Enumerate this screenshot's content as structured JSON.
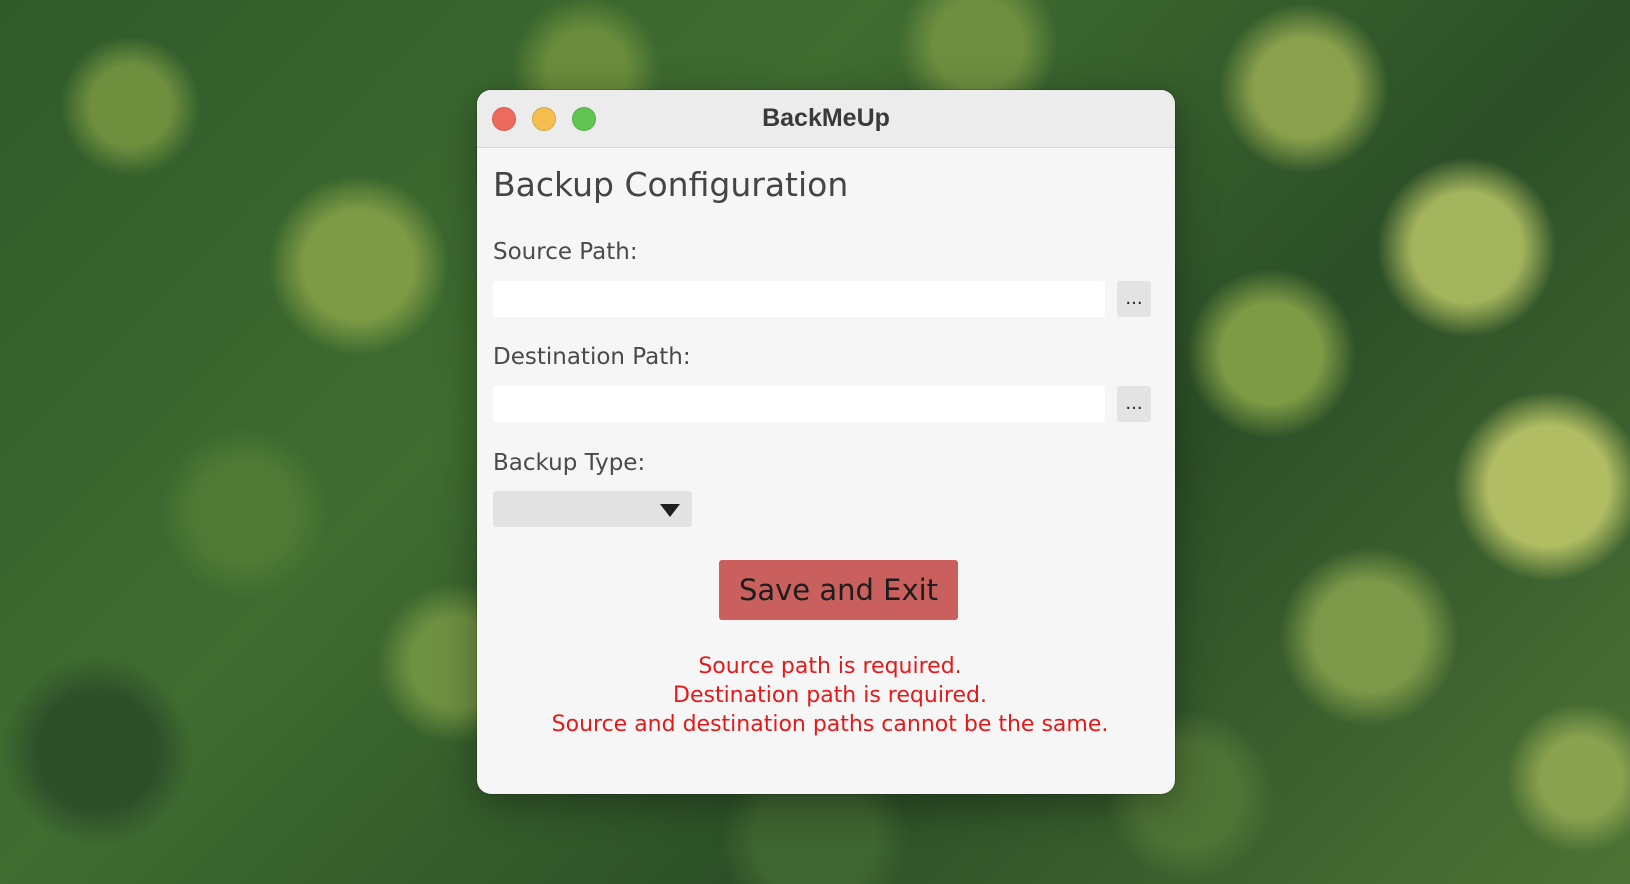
{
  "window": {
    "title": "BackMeUp"
  },
  "form": {
    "heading": "Backup Configuration",
    "source": {
      "label": "Source Path:",
      "value": "",
      "browse_label": "..."
    },
    "destination": {
      "label": "Destination Path:",
      "value": "",
      "browse_label": "..."
    },
    "backup_type": {
      "label": "Backup Type:",
      "selected": ""
    },
    "save_label": "Save and Exit"
  },
  "errors": [
    "Source path is required.",
    "Destination path is required.",
    "Source and destination paths cannot be the same."
  ],
  "colors": {
    "error_text": "#e31a1a",
    "save_button": "#c9605e",
    "close_light": "#ec6a5e",
    "minimize_light": "#f4bf4f",
    "zoom_light": "#61c554"
  }
}
